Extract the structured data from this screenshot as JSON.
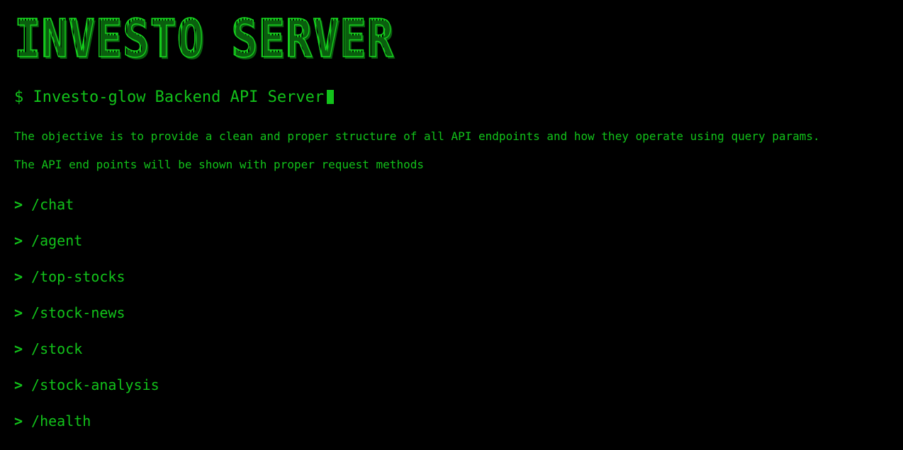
{
  "header": {
    "big_title": "INVESTO SERVER",
    "prompt_symbol": "$",
    "prompt_text": "Investo-glow Backend API Server"
  },
  "description": {
    "line1": "The objective is to provide a clean and proper structure of all API endpoints and how they operate using query params.",
    "line2": "The API end points will be shown with proper request methods"
  },
  "endpoints": [
    {
      "marker": ">",
      "path": "/chat"
    },
    {
      "marker": ">",
      "path": "/agent"
    },
    {
      "marker": ">",
      "path": "/top-stocks"
    },
    {
      "marker": ">",
      "path": "/stock-news"
    },
    {
      "marker": ">",
      "path": "/stock"
    },
    {
      "marker": ">",
      "path": "/stock-analysis"
    },
    {
      "marker": ">",
      "path": "/health"
    }
  ],
  "colors": {
    "background": "#000000",
    "terminal_green": "#12c21a",
    "title_shadow": "#0a5e0e"
  }
}
